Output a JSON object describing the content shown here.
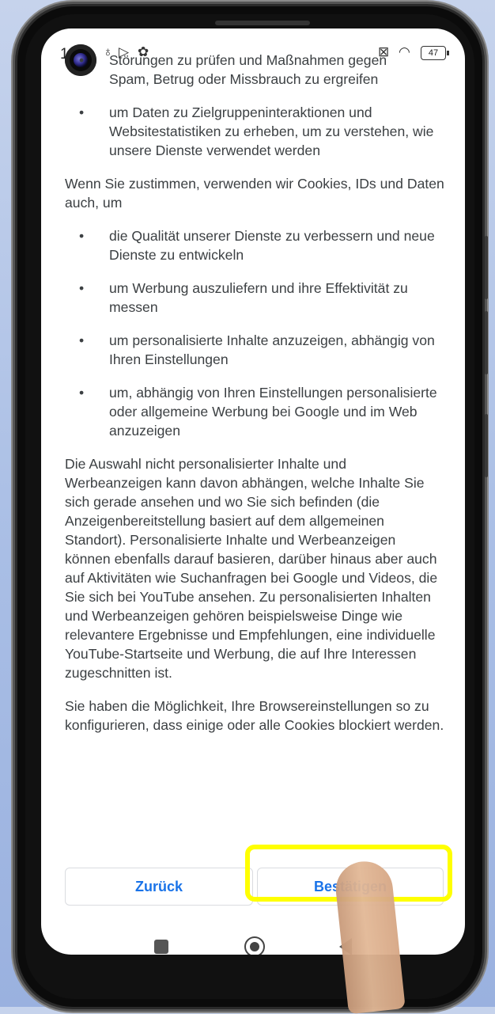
{
  "status_bar": {
    "time_partial": "1",
    "battery": "47"
  },
  "content": {
    "clipped_line": "Störungen zu prüfen und Maßnahmen gegen",
    "list1": [
      "Spam, Betrug oder Missbrauch zu ergreifen",
      "um Daten zu Zielgruppeninteraktionen und Websitestatistiken zu erheben, um zu verstehen, wie unsere Dienste verwendet werden"
    ],
    "para1": "Wenn Sie zustimmen, verwenden wir Cookies, IDs und Daten auch, um",
    "list2": [
      "die Qualität unserer Dienste zu verbessern und neue Dienste zu entwickeln",
      "um Werbung auszuliefern und ihre Effektivität zu messen",
      "um personalisierte Inhalte anzuzeigen, abhängig von Ihren Einstellungen",
      "um, abhängig von Ihren Einstellungen personalisierte oder allgemeine Werbung bei Google und im Web anzuzeigen"
    ],
    "para2": "Die Auswahl nicht personalisierter Inhalte und Werbeanzeigen kann davon abhängen, welche Inhalte Sie sich gerade ansehen und wo Sie sich befinden (die Anzeigenbereitstellung basiert auf dem allgemeinen Standort). Personalisierte Inhalte und Werbeanzeigen können ebenfalls darauf basieren, darüber hinaus aber auch auf Aktivitäten wie Suchanfragen bei Google und Videos, die Sie sich bei YouTube ansehen. Zu personalisierten Inhalten und Werbeanzeigen gehören beispielsweise Dinge wie relevantere Ergebnisse und Empfehlungen, eine individuelle YouTube-Startseite und Werbung, die auf Ihre Interessen zugeschnitten ist.",
    "para3": "Sie haben die Möglichkeit, Ihre Browsereinstellungen so zu konfigurieren, dass einige oder alle Cookies blockiert werden."
  },
  "buttons": {
    "back_label": "Zurück",
    "confirm_label": "Bestätigen"
  },
  "colors": {
    "accent": "#1a73e8",
    "highlight": "#ffff00",
    "text": "#3c4043"
  }
}
